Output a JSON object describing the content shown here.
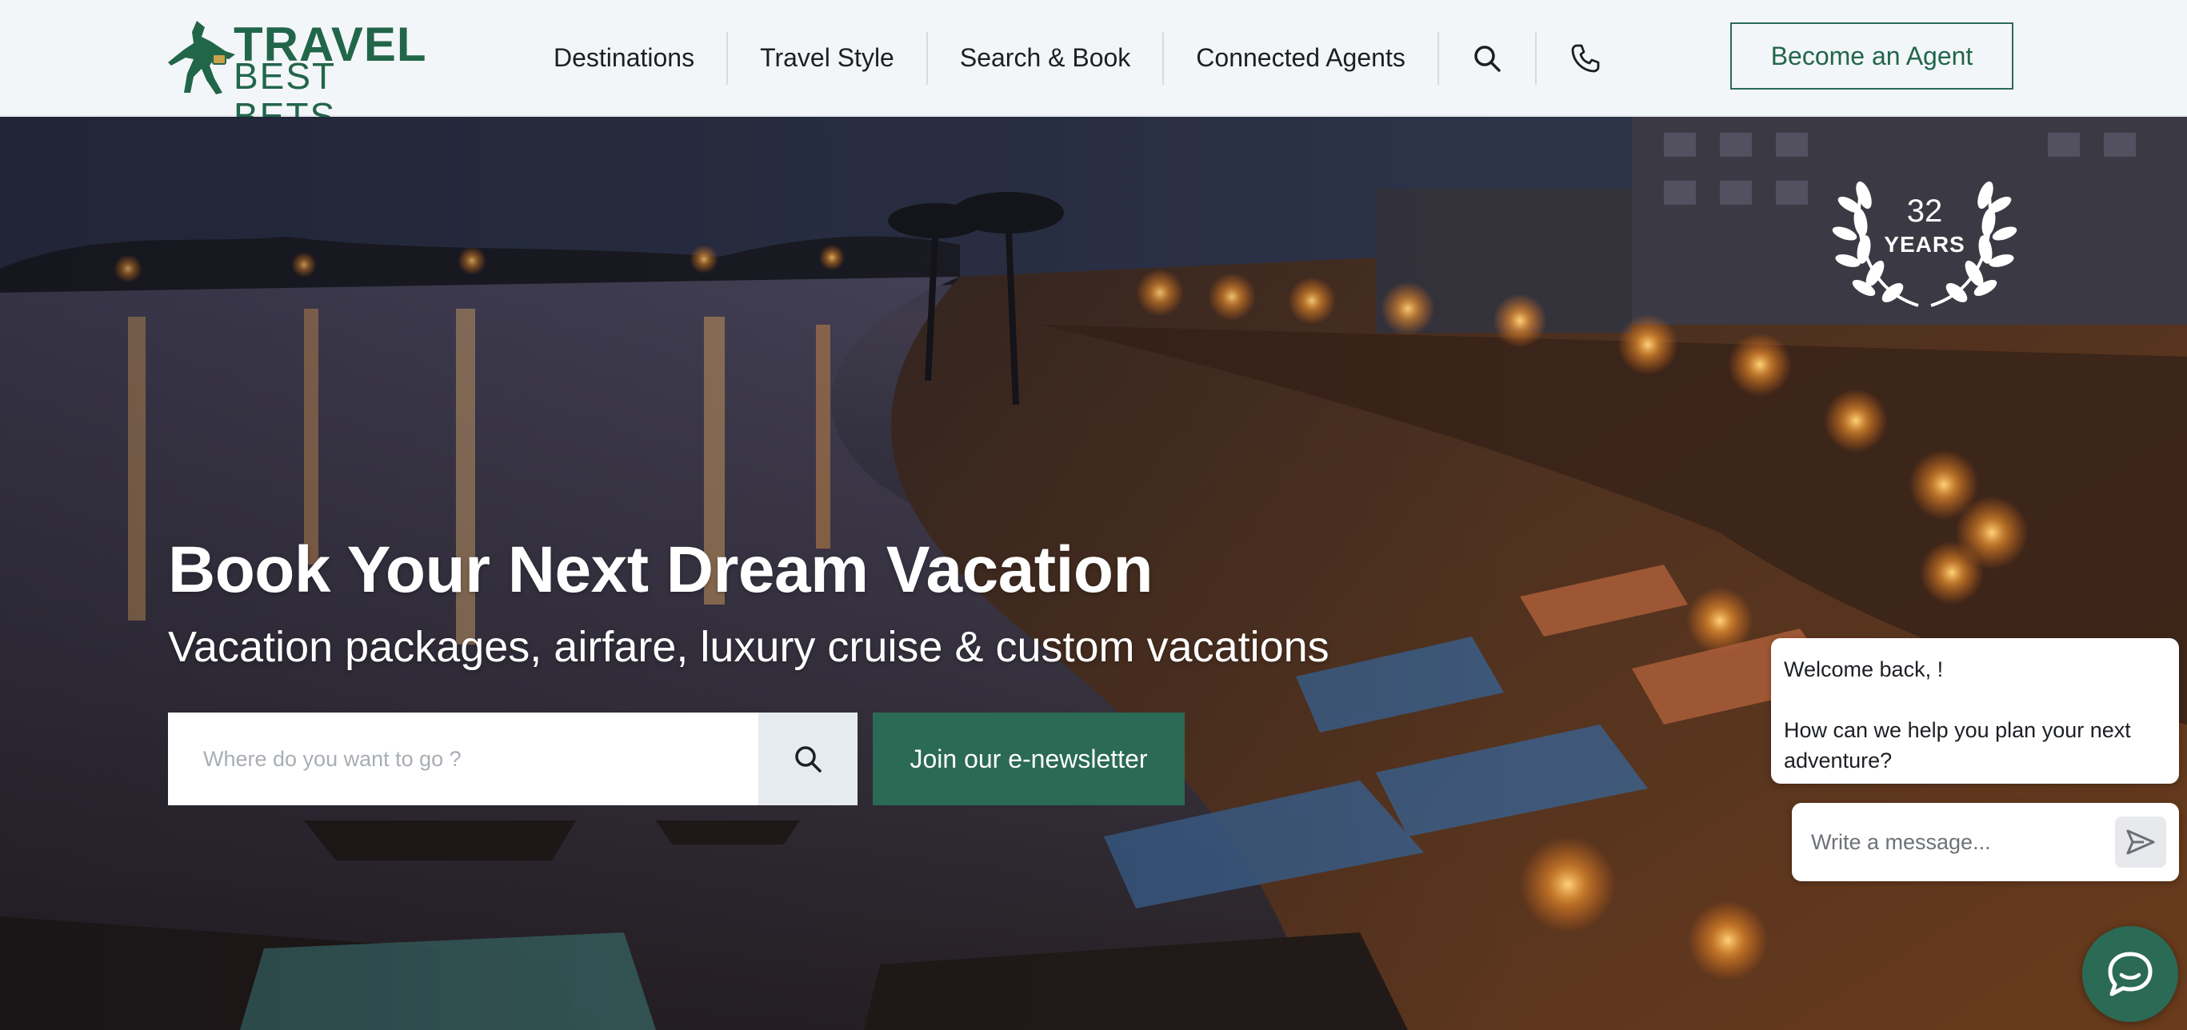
{
  "brand": {
    "line1": "TRAVEL",
    "line2": "BEST BETS",
    "color": "#22664a"
  },
  "nav": {
    "items": [
      {
        "label": "Destinations"
      },
      {
        "label": "Travel Style"
      },
      {
        "label": "Search & Book"
      },
      {
        "label": "Connected Agents"
      }
    ],
    "icons": [
      "search-icon",
      "phone-icon"
    ],
    "agent_button": "Become an Agent"
  },
  "hero": {
    "badge_number": "32",
    "badge_text": "YEARS",
    "title": "Book Your Next Dream Vacation",
    "subtitle": "Vacation packages, airfare, luxury cruise & custom vacations",
    "search_placeholder": "Where do you want to go ?",
    "newsletter_button": "Join our e-newsletter"
  },
  "chat": {
    "greeting": "Welcome back, !",
    "question": "How can we help you plan your next adventure?",
    "input_placeholder": "Write a message..."
  },
  "colors": {
    "accent": "#2b6a55",
    "header_bg": "#f3f6f9"
  }
}
